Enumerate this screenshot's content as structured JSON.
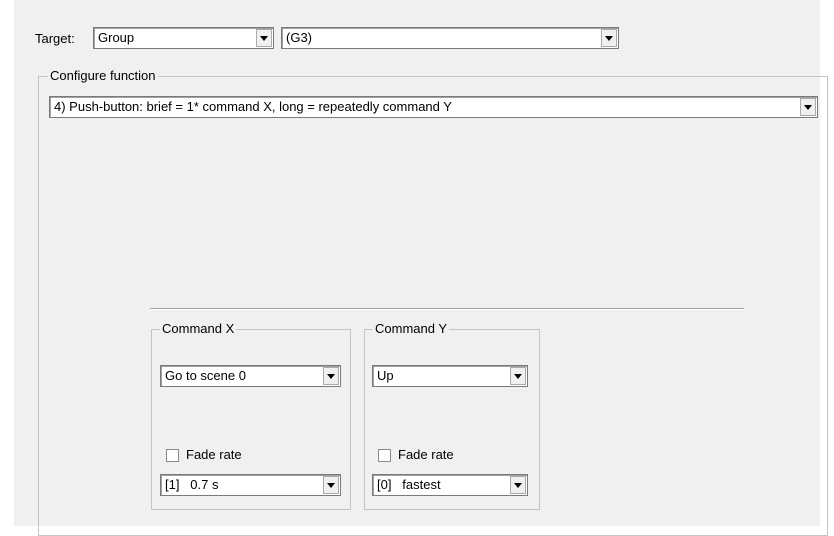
{
  "target": {
    "label": "Target:",
    "type_value": "Group",
    "group_value": "(G3)"
  },
  "configure": {
    "title": "Configure function",
    "function_value": "4) Push-button: brief = 1* command X, long = repeatedly command Y"
  },
  "command_x": {
    "title": "Command X",
    "command_value": "Go to scene 0",
    "fade_label": "Fade rate",
    "fade_checked": false,
    "fade_value": "[1]   0.7 s"
  },
  "command_y": {
    "title": "Command Y",
    "command_value": "Up",
    "fade_label": "Fade rate",
    "fade_checked": false,
    "fade_value": "[0]   fastest"
  },
  "icons": {
    "dropdown": "chevron-down-icon",
    "checkbox": "checkbox-icon"
  }
}
